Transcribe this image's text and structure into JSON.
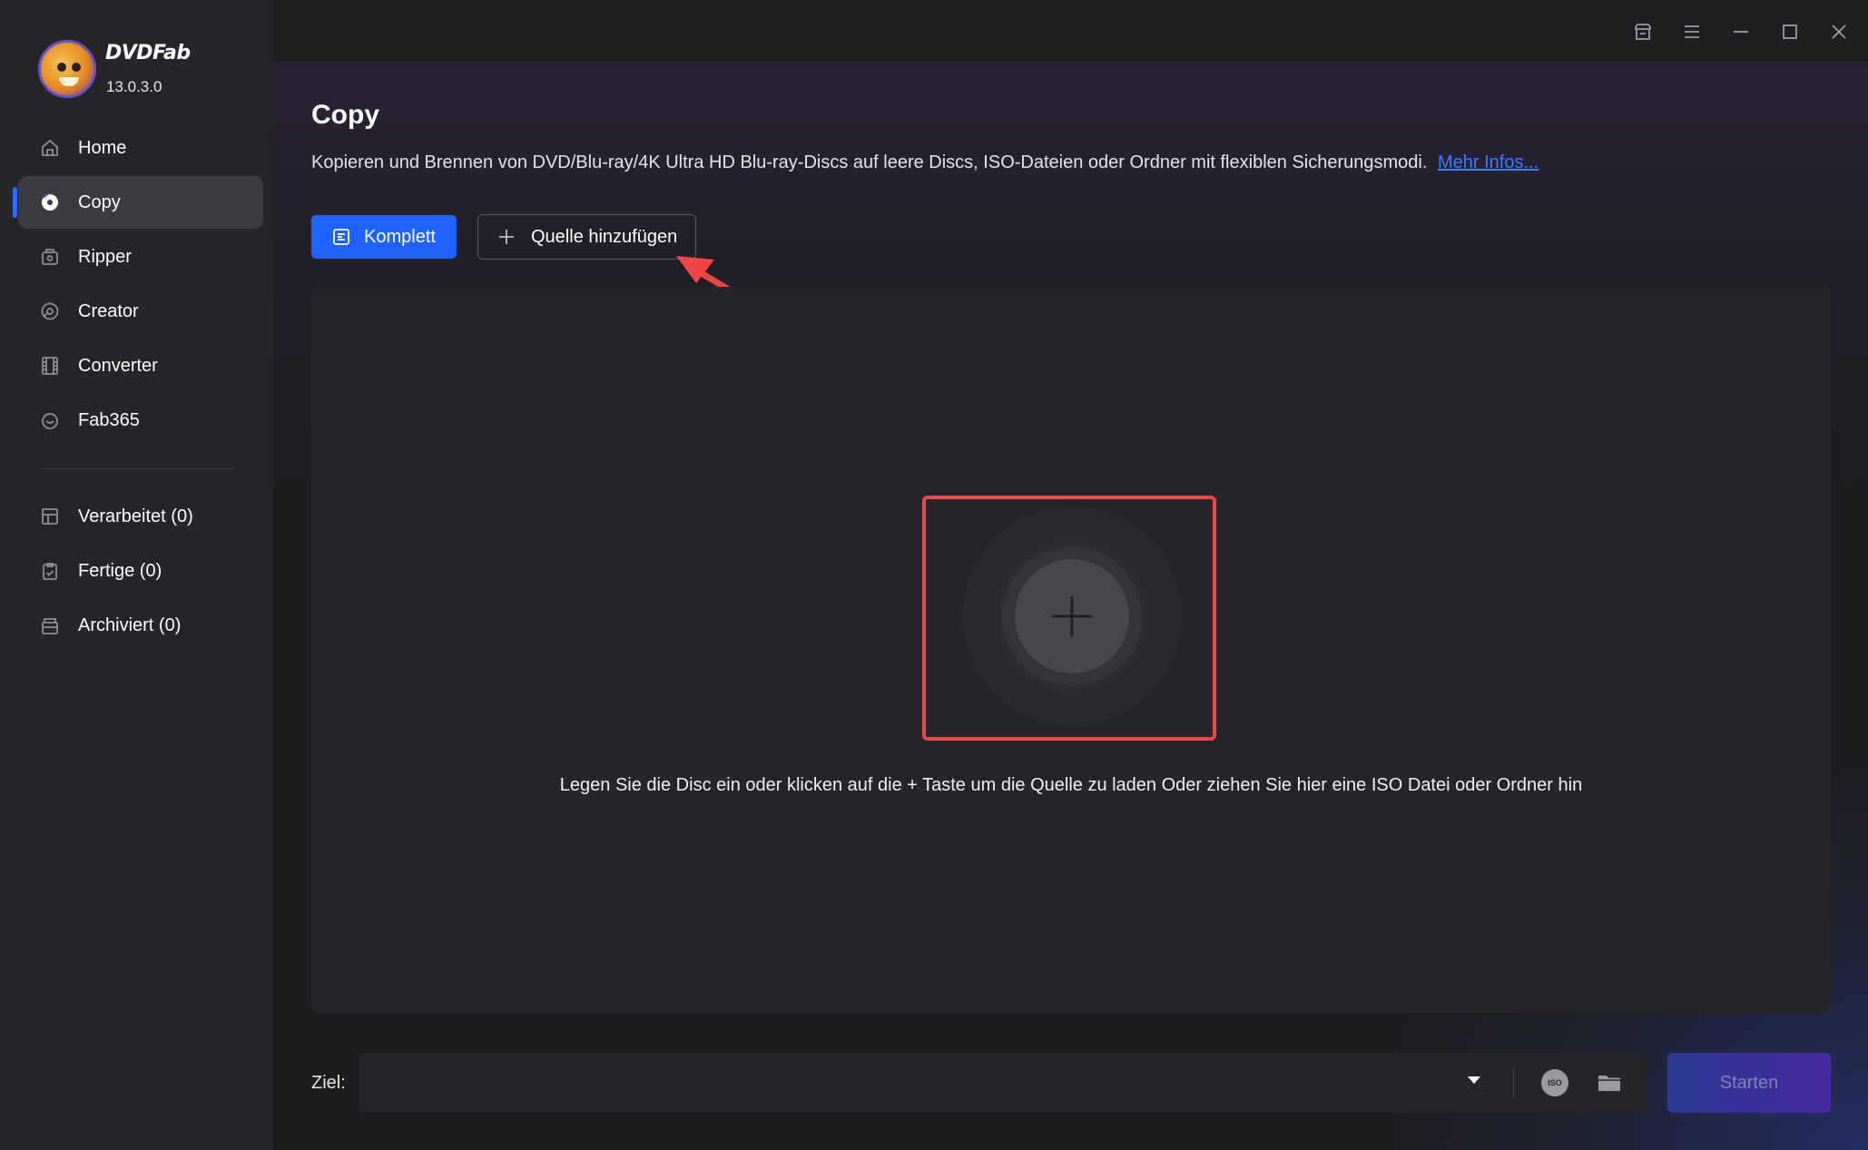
{
  "app": {
    "brand": "DVDFab",
    "version": "13.0.3.0"
  },
  "sidebar": {
    "items": [
      {
        "label": "Home",
        "icon": "home-icon"
      },
      {
        "label": "Copy",
        "icon": "copy-disc-icon",
        "active": true
      },
      {
        "label": "Ripper",
        "icon": "ripper-icon"
      },
      {
        "label": "Creator",
        "icon": "creator-icon"
      },
      {
        "label": "Converter",
        "icon": "converter-film-icon"
      },
      {
        "label": "Fab365",
        "icon": "fab365-icon"
      }
    ],
    "queue": [
      {
        "label": "Verarbeitet (0)",
        "icon": "processing-list-icon"
      },
      {
        "label": "Fertige (0)",
        "icon": "finished-clipboard-icon"
      },
      {
        "label": "Archiviert (0)",
        "icon": "archive-box-icon"
      }
    ]
  },
  "main": {
    "title": "Copy",
    "description": "Kopieren und Brennen von DVD/Blu-ray/4K Ultra HD Blu-ray-Discs auf leere Discs, ISO-Dateien oder Ordner mit flexiblen Sicherungsmodi.",
    "more_link": "Mehr Infos...",
    "mode_button": "Komplett",
    "add_source_button": "Quelle hinzufügen",
    "hint": "Legen Sie die Disc ein oder klicken auf die + Taste um die Quelle zu laden Oder ziehen Sie hier eine ISO Datei oder Ordner hin",
    "ziel_label": "Ziel:",
    "iso_label": "ISO",
    "start_button": "Starten"
  },
  "colors": {
    "accent": "#1f62ff",
    "highlight": "#e84848",
    "link": "#3a7dff"
  }
}
